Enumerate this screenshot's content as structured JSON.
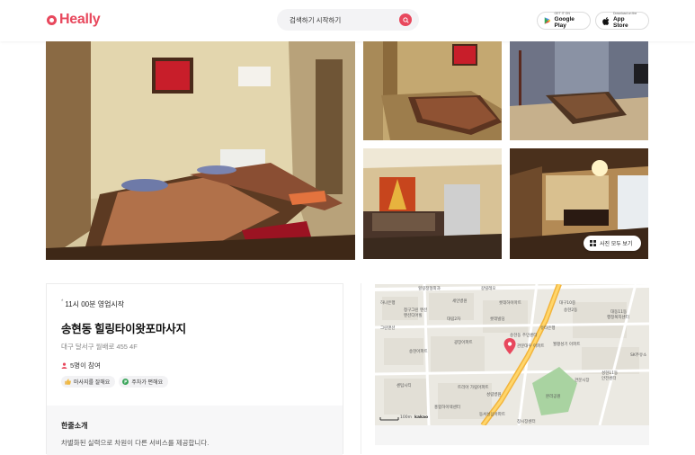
{
  "header": {
    "logo_text": "Heally",
    "search": {
      "value": "검색하기 시작하기"
    },
    "google_play": {
      "small": "GET IT ON",
      "label": "Google Play"
    },
    "app_store": {
      "small": "Download on the",
      "label": "App Store"
    }
  },
  "gallery": {
    "view_all_label": "사진 모두 보기"
  },
  "shop": {
    "open_time": "11시 00분 영업시작",
    "name": "송현동 힐링타이왓포마사지",
    "address": "대구 달서구 월배로 455 4F",
    "participants": "5명이 참여",
    "tags": [
      "마사지를 잘해요",
      "주차가 편해요"
    ],
    "intro_title": "한줄소개",
    "intro_text": "차별화된 실력으로 차원이 다른 서비스를 제공합니다."
  },
  "map": {
    "scale_label": "100m",
    "provider": "kakao",
    "labels": [
      "힐링정형외과",
      "갈릴레오",
      "하나은행",
      "세인병원",
      "롯데하이마트",
      "대구10중",
      "청구그린 맨션",
      "맨션디어빌",
      "대림2차",
      "롯데빌딩",
      "그린맨션",
      "대동11동",
      "송현2동",
      "행정복지센터",
      "광장아파트",
      "유타은행",
      "SK주유소",
      "월평성기 아파트",
      "송현아파트",
      "관문대우 아파트",
      "송현동 주민센터",
      "성현11동",
      "안전센터",
      "센텀시티",
      "트리아 가림아파트",
      "성림병원",
      "관문시장",
      "홍합하이텍센터",
      "동서성심아파트",
      "창시장센터",
      "본리공원"
    ]
  },
  "colors": {
    "brand": "#e8485d"
  }
}
